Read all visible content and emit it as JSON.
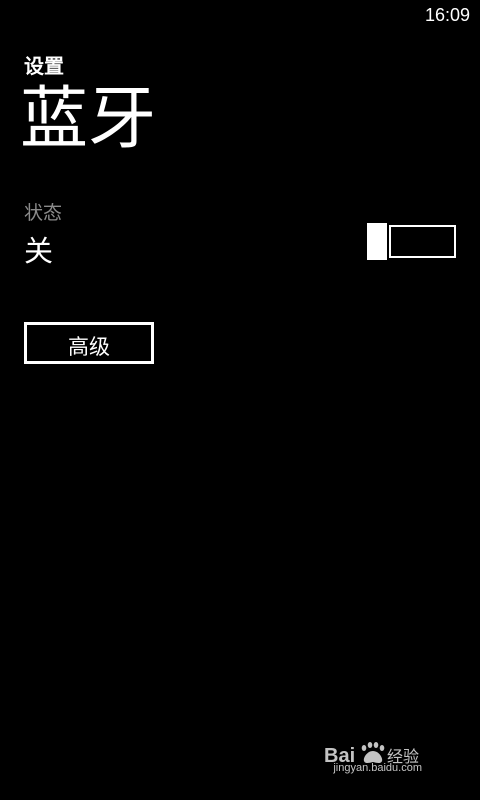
{
  "status_bar": {
    "time": "16:09"
  },
  "header": {
    "app_title": "设置",
    "page_title": "蓝牙"
  },
  "bluetooth_state": {
    "label": "状态",
    "value": "关",
    "enabled": false
  },
  "advanced": {
    "label": "高级"
  },
  "watermark": {
    "brand": "Bai du 经验",
    "url": "jingyan.baidu.com"
  },
  "colors": {
    "background": "#000000",
    "foreground": "#ffffff",
    "secondary_text": "#8a8a8a"
  }
}
